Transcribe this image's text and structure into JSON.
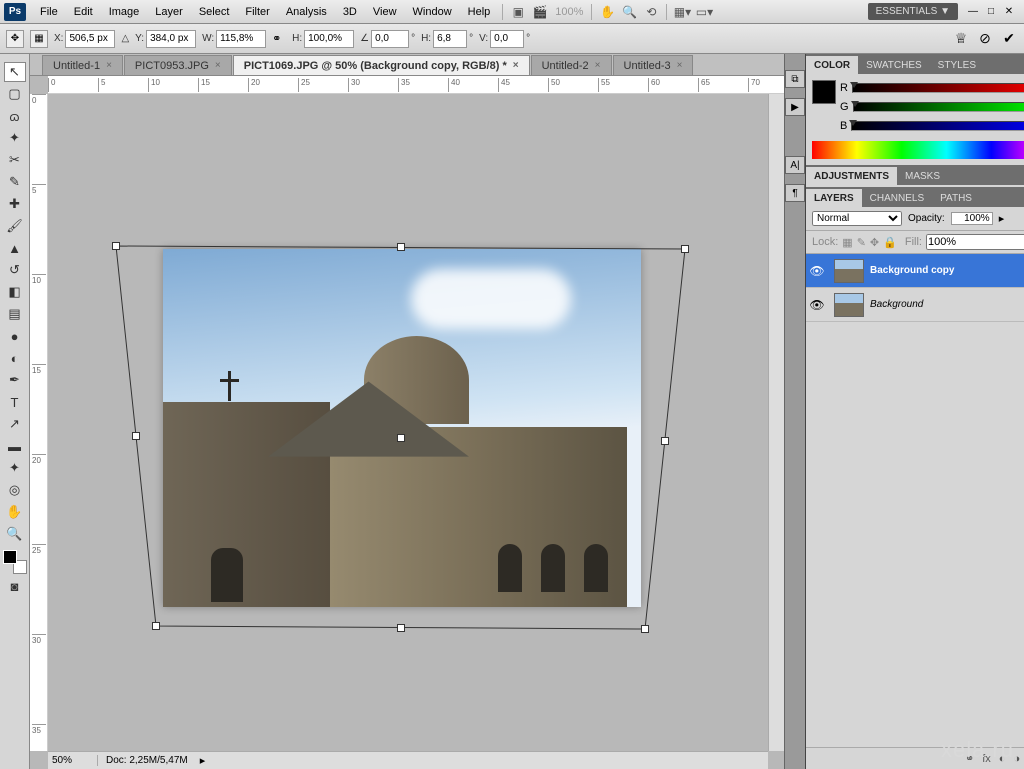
{
  "menubar": {
    "items": [
      "File",
      "Edit",
      "Image",
      "Layer",
      "Select",
      "Filter",
      "Analysis",
      "3D",
      "View",
      "Window",
      "Help"
    ],
    "zoom": "100%",
    "workspace": "ESSENTIALS ▼"
  },
  "optionsbar": {
    "x_label": "X:",
    "x_val": "506,5 px",
    "y_label": "Y:",
    "y_val": "384,0 px",
    "w_label": "W:",
    "w_val": "115,8%",
    "h_label": "H:",
    "h_val": "100,0%",
    "angle_label": "∠",
    "angle_val": "0,0",
    "shear_h_label": "H:",
    "shear_h_val": "6,8",
    "shear_v_label": "V:",
    "shear_v_val": "0,0",
    "deg": "°"
  },
  "tabs": [
    {
      "label": "Untitled-1"
    },
    {
      "label": "PICT0953.JPG"
    },
    {
      "label": "PICT1069.JPG @ 50% (Background copy, RGB/8) *",
      "active": true
    },
    {
      "label": "Untitled-2"
    },
    {
      "label": "Untitled-3"
    }
  ],
  "statusbar": {
    "zoom": "50%",
    "docsize": "Doc: 2,25M/5,47M"
  },
  "panels": {
    "color": {
      "tabs": [
        "COLOR",
        "SWATCHES",
        "STYLES"
      ],
      "r": "0",
      "g": "0",
      "b": "0"
    },
    "adjustments": {
      "tabs": [
        "ADJUSTMENTS",
        "MASKS"
      ]
    },
    "layers": {
      "tabs": [
        "LAYERS",
        "CHANNELS",
        "PATHS"
      ],
      "blend": "Normal",
      "opacity_label": "Opacity:",
      "opacity": "100%",
      "lock_label": "Lock:",
      "fill_label": "Fill:",
      "fill": "100%",
      "list": [
        {
          "name": "Background copy",
          "selected": true
        },
        {
          "name": "Background",
          "locked": true
        }
      ]
    }
  },
  "watermark": "xela.ru"
}
